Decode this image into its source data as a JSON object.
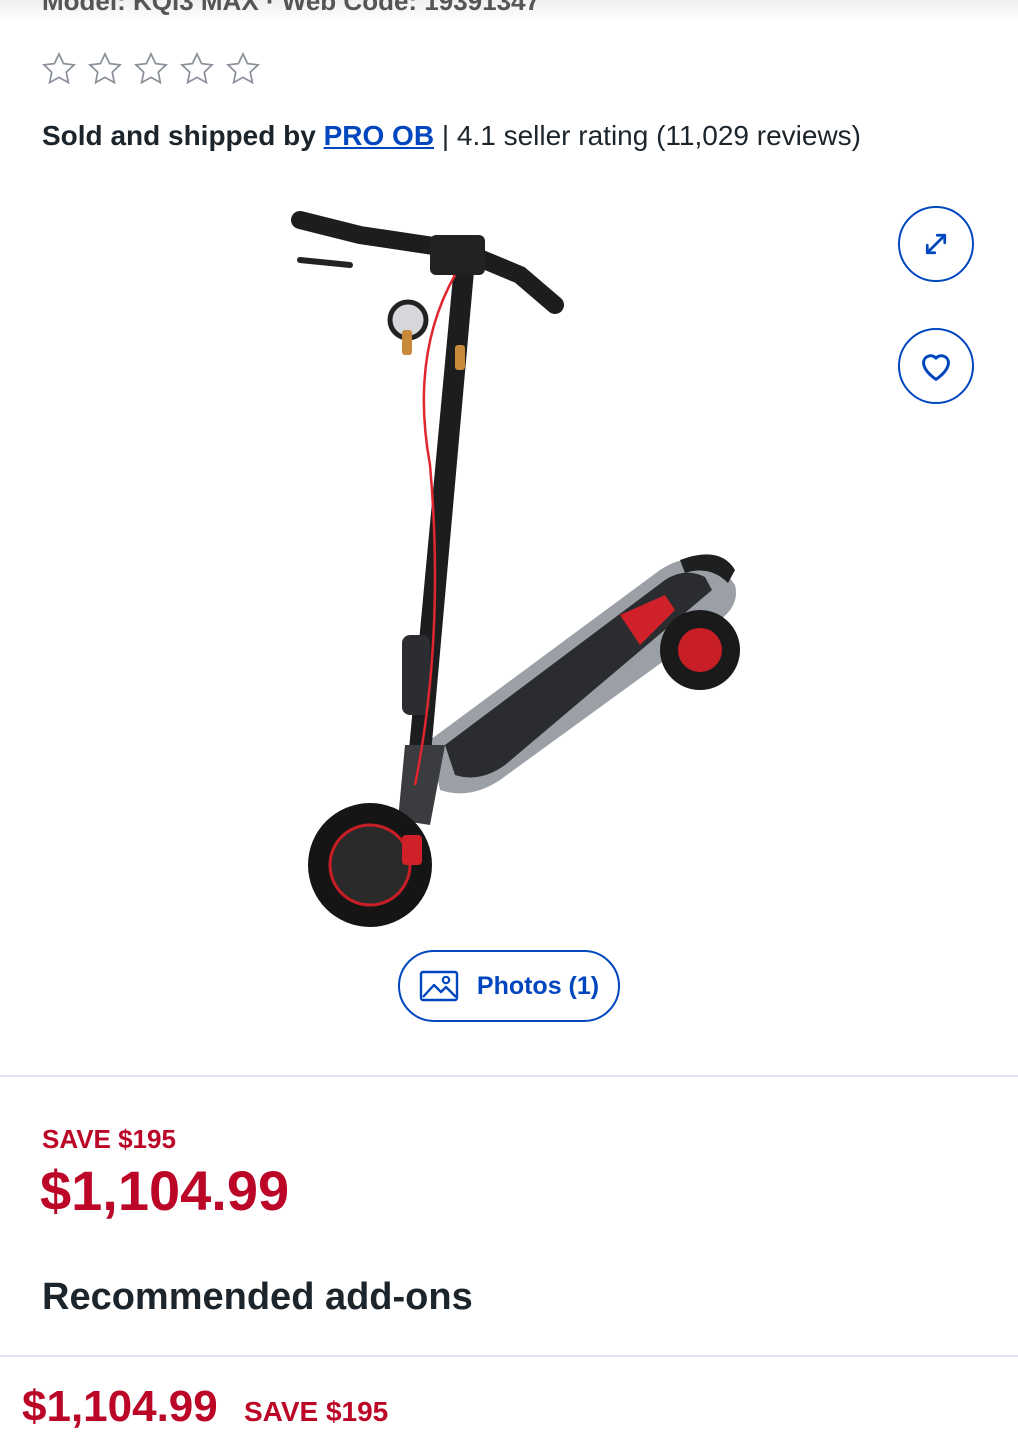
{
  "header": {
    "cut_off_text": "Model: KQi3 MAX · Web Code: 19391347"
  },
  "rating": {
    "stars_filled": 0,
    "stars_total": 5
  },
  "seller": {
    "prefix": "Sold and shipped by",
    "name": "PRO OB",
    "separator": "|",
    "rating_text": "4.1 seller rating (11,029 reviews)"
  },
  "media": {
    "photos_label": "Photos (1)",
    "expand_icon": "expand-icon",
    "favorite_icon": "heart-icon",
    "gallery_icon": "image-icon"
  },
  "pricing": {
    "save_label": "SAVE $195",
    "price": "$1,104.99"
  },
  "addons": {
    "heading": "Recommended add-ons"
  },
  "sticky_bar": {
    "price": "$1,104.99",
    "save_label": "SAVE $195"
  },
  "colors": {
    "link_blue": "#0046be",
    "sale_red": "#bb0628",
    "text_dark": "#1d252c"
  }
}
